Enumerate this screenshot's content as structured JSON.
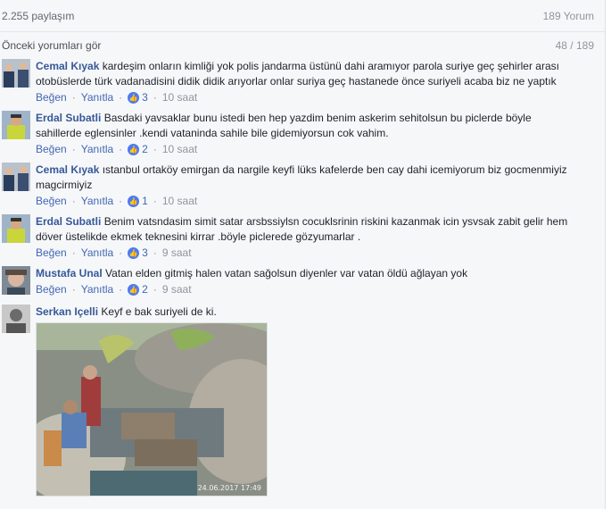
{
  "topbar": {
    "shares": "2.255 paylaşım",
    "comments_total": "189 Yorum"
  },
  "previous": {
    "link": "Önceki yorumları gör",
    "counter": "48 / 189"
  },
  "labels": {
    "like": "Beğen",
    "reply": "Yanıtla"
  },
  "comments": [
    {
      "author": "Cemal Kıyak",
      "text": "kardeşim onların kimliği yok polis jandarma üstünü dahi aramıyor parola suriye geç şehirler arası otobüslerde türk vadanadisini didik didik arıyorlar onlar suriya geç hastanede önce suriyeli acaba biz ne yaptık",
      "likes": "3",
      "time": "10 saat"
    },
    {
      "author": "Erdal Subatli",
      "text": "Basdaki yavsaklar bunu istedi ben hep yazdim benim askerim sehitolsun bu piclerde böyle sahillerde eglensinler .kendi vataninda sahile bile gidemiyorsun cok vahim.",
      "likes": "2",
      "time": "10 saat"
    },
    {
      "author": "Cemal Kıyak",
      "text": "ıstanbul ortaköy emirgan da nargile keyfi lüks kafelerde ben cay dahi icemiyorum biz gocmenmiyiz magcirmiyiz",
      "likes": "1",
      "time": "10 saat"
    },
    {
      "author": "Erdal Subatli",
      "text": "Benim vatsndasim simit satar arsbssiylsn cocuklsrinin riskini kazanmak icin ysvsak zabit gelir hem döver üstelikde ekmek teknesini kirrar .böyle piclerede gözyumarlar .",
      "likes": "3",
      "time": "9 saat"
    },
    {
      "author": "Mustafa Unal",
      "text": "Vatan elden gitmiş halen vatan sağolsun diyenler var vatan öldü ağlayan yok",
      "likes": "2",
      "time": "9 saat"
    },
    {
      "author": "Serkan Içelli",
      "text": "Keyf e bak suriyeli de ki."
    }
  ],
  "photo": {
    "timestamp": "24.06.2017 17:49"
  },
  "colors": {
    "link": "#4267b2",
    "author": "#365899",
    "like_badge": "#4b7bf5"
  }
}
